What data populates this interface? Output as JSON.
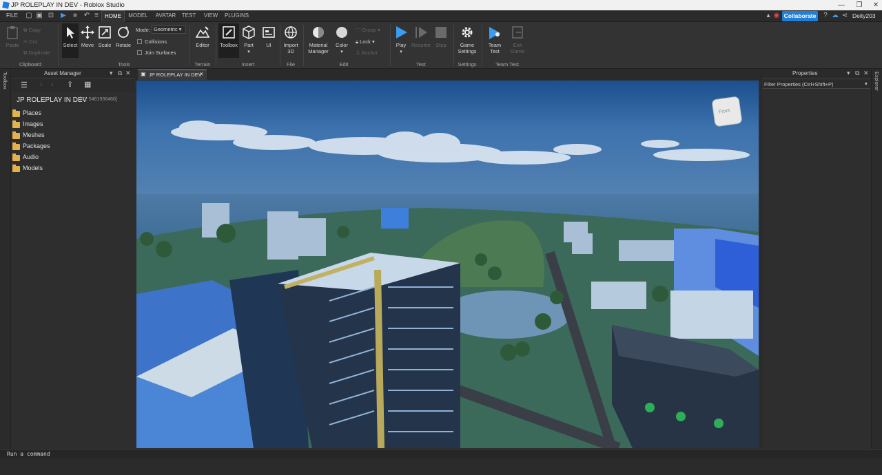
{
  "window": {
    "title": "JP ROLEPLAY IN DEV - Roblox Studio",
    "controls": [
      "—",
      "❐",
      "✕"
    ]
  },
  "menubar": {
    "file": "FILE",
    "tabs": [
      "HOME",
      "MODEL",
      "AVATAR",
      "TEST",
      "VIEW",
      "PLUGINS"
    ],
    "active_tab": "HOME",
    "collaborate": "Collaborate",
    "user": "Deity203"
  },
  "ribbon": {
    "clipboard": {
      "paste": "Paste",
      "copy": "Copy",
      "cut": "Cut",
      "duplicate": "Duplicate",
      "group": "Clipboard"
    },
    "tools": {
      "select": "Select",
      "move": "Move",
      "scale": "Scale",
      "rotate": "Rotate",
      "mode_label": "Mode:",
      "mode_value": "Geometric",
      "collisions": "Collisions",
      "join_surfaces": "Join Surfaces",
      "group": "Tools"
    },
    "terrain": {
      "editor": "Editor",
      "group": "Terrain"
    },
    "insert": {
      "toolbox": "Toolbox",
      "part": "Part",
      "ui": "UI",
      "group": "Insert"
    },
    "file": {
      "import3d": [
        "Import",
        "3D"
      ],
      "group": "File"
    },
    "edit": {
      "material_manager": [
        "Material",
        "Manager"
      ],
      "color": "Color",
      "group_btn": "Group",
      "lock": "Lock",
      "anchor": "Anchor",
      "group": "Edit"
    },
    "test": {
      "play": "Play",
      "resume": "Resume",
      "stop": "Stop",
      "group": "Test"
    },
    "settings": {
      "game_settings": [
        "Game",
        "Settings"
      ],
      "group": "Settings"
    },
    "team_test": {
      "team_test": [
        "Team",
        "Test"
      ],
      "exit_game": [
        "Exit",
        "Game"
      ],
      "group": "Team Test"
    }
  },
  "left_strip": {
    "label": "Toolbox"
  },
  "right_strip": {
    "label": "Explorer"
  },
  "asset_manager": {
    "title": "Asset Manager",
    "game_name": "JP ROLEPLAY IN DEV",
    "game_id": "[ID: 5461936460]",
    "folders": [
      "Places",
      "Images",
      "Meshes",
      "Packages",
      "Audio",
      "Models"
    ]
  },
  "viewport": {
    "tab_label": "JP ROLEPLAY IN DEV",
    "view_cube_label": "Front"
  },
  "properties": {
    "title": "Properties",
    "filter_placeholder": "Filter Properties (Ctrl+Shift+P)"
  },
  "command_bar": {
    "placeholder": "Run a command"
  },
  "colors": {
    "accent": "#1f7fd9",
    "folder": "#e4b24a",
    "play": "#3b9cf0"
  }
}
